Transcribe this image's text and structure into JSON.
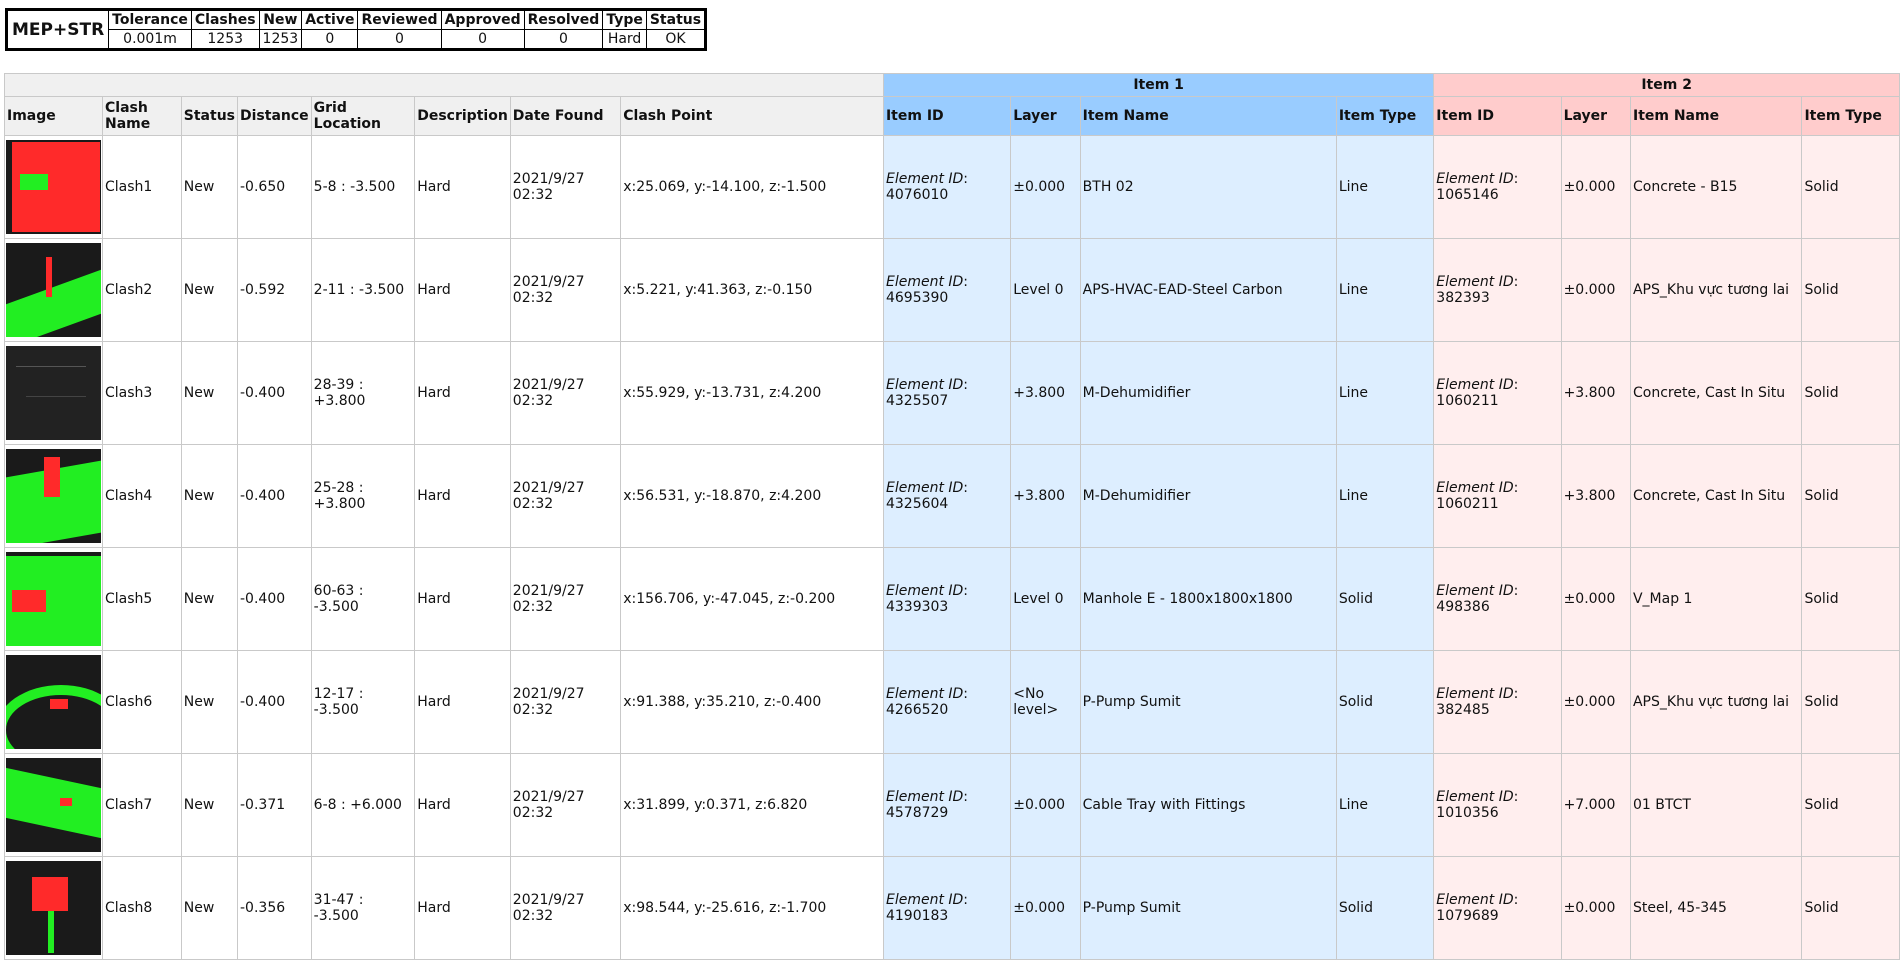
{
  "summary": {
    "project": "MEP+STR",
    "headers": [
      "Tolerance",
      "Clashes",
      "New",
      "Active",
      "Reviewed",
      "Approved",
      "Resolved",
      "Type",
      "Status"
    ],
    "values": [
      "0.001m",
      "1253",
      "1253",
      "0",
      "0",
      "0",
      "0",
      "Hard",
      "OK"
    ]
  },
  "groups": {
    "item1": "Item 1",
    "item2": "Item 2"
  },
  "columns": {
    "image": "Image",
    "clash_name": "Clash Name",
    "status": "Status",
    "distance": "Distance",
    "grid_location": "Grid Location",
    "description": "Description",
    "date_found": "Date Found",
    "clash_point": "Clash Point",
    "item_id": "Item ID",
    "layer": "Layer",
    "item_name": "Item Name",
    "item_type": "Item Type"
  },
  "element_id_label": "Element ID",
  "rows": [
    {
      "name": "Clash1",
      "status": "New",
      "distance": "-0.650",
      "grid": "5-8 : -3.500",
      "desc": "Hard",
      "date": "2021/9/27",
      "time": "02:32",
      "point": "x:25.069, y:-14.100, z:-1.500",
      "i1_id": "4076010",
      "i1_layer": "±0.000",
      "i1_name": "BTH 02",
      "i1_type": "Line",
      "i2_id": "1065146",
      "i2_layer": "±0.000",
      "i2_name": "Concrete - B15",
      "i2_type": "Solid",
      "thumb": "red-box"
    },
    {
      "name": "Clash2",
      "status": "New",
      "distance": "-0.592",
      "grid": "2-11 : -3.500",
      "desc": "Hard",
      "date": "2021/9/27",
      "time": "02:32",
      "point": "x:5.221, y:41.363, z:-0.150",
      "i1_id": "4695390",
      "i1_layer": "Level 0",
      "i1_name": "APS-HVAC-EAD-Steel Carbon",
      "i1_type": "Line",
      "i2_id": "382393",
      "i2_layer": "±0.000",
      "i2_name": "APS_Khu vực tương lai",
      "i2_type": "Solid",
      "thumb": "green-slab"
    },
    {
      "name": "Clash3",
      "status": "New",
      "distance": "-0.400",
      "grid": "28-39 : +3.800",
      "desc": "Hard",
      "date": "2021/9/27",
      "time": "02:32",
      "point": "x:55.929, y:-13.731, z:4.200",
      "i1_id": "4325507",
      "i1_layer": "+3.800",
      "i1_name": "M-Dehumidifier",
      "i1_type": "Line",
      "i2_id": "1060211",
      "i2_layer": "+3.800",
      "i2_name": "Concrete, Cast In Situ",
      "i2_type": "Solid",
      "thumb": "dark"
    },
    {
      "name": "Clash4",
      "status": "New",
      "distance": "-0.400",
      "grid": "25-28 : +3.800",
      "desc": "Hard",
      "date": "2021/9/27",
      "time": "02:32",
      "point": "x:56.531, y:-18.870, z:4.200",
      "i1_id": "4325604",
      "i1_layer": "+3.800",
      "i1_name": "M-Dehumidifier",
      "i1_type": "Line",
      "i2_id": "1060211",
      "i2_layer": "+3.800",
      "i2_name": "Concrete, Cast In Situ",
      "i2_type": "Solid",
      "thumb": "green-red-post"
    },
    {
      "name": "Clash5",
      "status": "New",
      "distance": "-0.400",
      "grid": "60-63 : -3.500",
      "desc": "Hard",
      "date": "2021/9/27",
      "time": "02:32",
      "point": "x:156.706, y:-47.045, z:-0.200",
      "i1_id": "4339303",
      "i1_layer": "Level 0",
      "i1_name": "Manhole E - 1800x1800x1800",
      "i1_type": "Solid",
      "i2_id": "498386",
      "i2_layer": "±0.000",
      "i2_name": "V_Map 1",
      "i2_type": "Solid",
      "thumb": "green-red-block"
    },
    {
      "name": "Clash6",
      "status": "New",
      "distance": "-0.400",
      "grid": "12-17 : -3.500",
      "desc": "Hard",
      "date": "2021/9/27",
      "time": "02:32",
      "point": "x:91.388, y:35.210, z:-0.400",
      "i1_id": "4266520",
      "i1_layer": "<No level>",
      "i1_name": "P-Pump Sumit",
      "i1_type": "Solid",
      "i2_id": "382485",
      "i2_layer": "±0.000",
      "i2_name": "APS_Khu vực tương lai",
      "i2_type": "Solid",
      "thumb": "green-curve"
    },
    {
      "name": "Clash7",
      "status": "New",
      "distance": "-0.371",
      "grid": "6-8 : +6.000",
      "desc": "Hard",
      "date": "2021/9/27",
      "time": "02:32",
      "point": "x:31.899, y:0.371, z:6.820",
      "i1_id": "4578729",
      "i1_layer": "±0.000",
      "i1_name": "Cable Tray with Fittings",
      "i1_type": "Line",
      "i2_id": "1010356",
      "i2_layer": "+7.000",
      "i2_name": "01 BTCT",
      "i2_type": "Solid",
      "thumb": "green-frame"
    },
    {
      "name": "Clash8",
      "status": "New",
      "distance": "-0.356",
      "grid": "31-47 : -3.500",
      "desc": "Hard",
      "date": "2021/9/27",
      "time": "02:32",
      "point": "x:98.544, y:-25.616, z:-1.700",
      "i1_id": "4190183",
      "i1_layer": "±0.000",
      "i1_name": "P-Pump Sumit",
      "i1_type": "Solid",
      "i2_id": "1079689",
      "i2_layer": "±0.000",
      "i2_name": "Steel, 45-345",
      "i2_type": "Solid",
      "thumb": "red-cube-pole"
    }
  ],
  "colors": {
    "item1_header": "#99ccff",
    "item1_cell": "#ddeeff",
    "item2_header": "#ffcccc",
    "item2_cell": "#ffeeee",
    "clash_red": "#ff2a2a",
    "clash_green": "#22ee22"
  }
}
